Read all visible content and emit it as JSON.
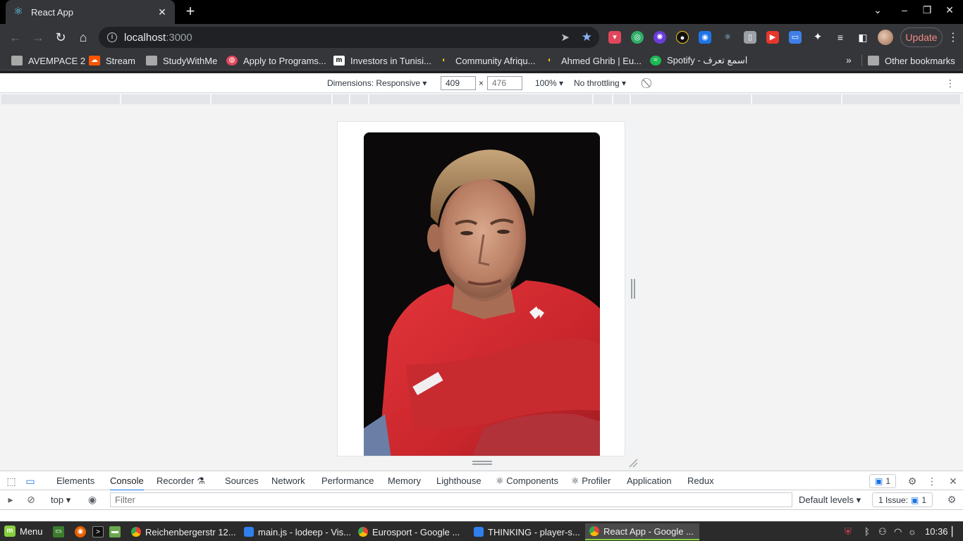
{
  "browser": {
    "tab": {
      "title": "React App",
      "favicon": "react-icon"
    },
    "url": {
      "host": "localhost",
      "port": ":3000"
    },
    "update_label": "Update",
    "bookmarks": [
      {
        "label": "AVEMPACE 2",
        "icon": "folder-icon"
      },
      {
        "label": "Stream",
        "icon": "soundcloud-icon"
      },
      {
        "label": "StudyWithMe",
        "icon": "folder-icon"
      },
      {
        "label": "Apply to Programs...",
        "icon": "globe-icon"
      },
      {
        "label": "Investors in Tunisi...",
        "icon": "m-icon"
      },
      {
        "label": "Community Afriqu...",
        "icon": "moon-icon"
      },
      {
        "label": "Ahmed Ghrib | Eu...",
        "icon": "moon-icon"
      },
      {
        "label": "Spotify - اسمع تعرف",
        "icon": "spotify-icon"
      }
    ],
    "other_bookmarks": "Other bookmarks"
  },
  "device_toolbar": {
    "dimensions_label": "Dimensions: Responsive",
    "width": "409",
    "height_placeholder": "476",
    "times": "×",
    "zoom": "100%",
    "throttling": "No throttling"
  },
  "devtools": {
    "tabs": [
      "Elements",
      "Console",
      "Recorder",
      "Sources",
      "Network",
      "Performance",
      "Memory",
      "Lighthouse",
      "Components",
      "Profiler",
      "Application",
      "Redux"
    ],
    "active_tab": "Console",
    "issues_badge_count": "1",
    "context": "top",
    "filter_placeholder": "Filter",
    "levels": "Default levels",
    "issue_count_label": "1 Issue:",
    "issue_count": "1"
  },
  "taskbar": {
    "menu_label": "Menu",
    "tasks": [
      "Reichenbergerstr 12...",
      "main.js - lodeep - Vis...",
      "Eurosport - Google ...",
      "THINKING - player-s...",
      "React App - Google ..."
    ],
    "active_task": "React App - Google ...",
    "clock": "10:36"
  },
  "colors": {
    "accent": "#1a73e8",
    "update": "#f28b82",
    "shirt_red": "#d42a2e",
    "mint_green": "#87cf3e"
  }
}
